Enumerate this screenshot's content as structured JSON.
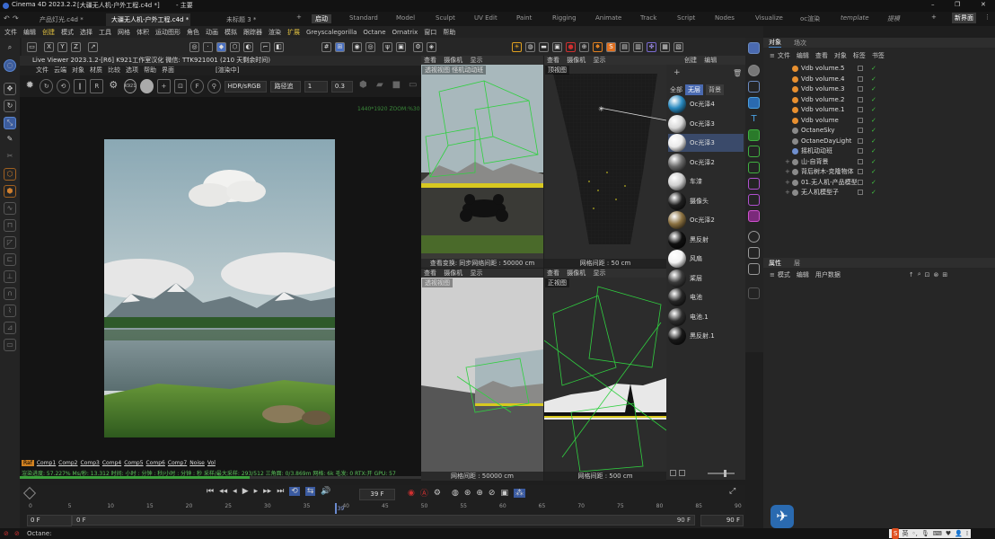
{
  "title": {
    "app_version": "Cinema 4D 2023.2.2",
    "document": "[大疆无人机-户外工程.c4d *]",
    "suffix": "- 主要"
  },
  "window_controls": [
    "–",
    "❐",
    "✕"
  ],
  "doc_tabs": [
    "产品灯光.c4d *",
    "大疆无人机-户外工程.c4d *",
    "未标题 3 *"
  ],
  "layout_tabs": {
    "items": [
      "启动",
      "Standard",
      "Model",
      "Sculpt",
      "UV Edit",
      "Paint",
      "Rigging",
      "Animate",
      "Track",
      "Script",
      "Nodes",
      "Visualize",
      "oc渲染",
      "template",
      "提模"
    ],
    "active": "启动",
    "new_interface": "新界面"
  },
  "menu": [
    "文件",
    "编辑",
    "创建",
    "模式",
    "选择",
    "工具",
    "网格",
    "体积",
    "运动图形",
    "角色",
    "动画",
    "模拟",
    "跟踪器",
    "渲染",
    "扩展",
    "Greyscalegorilla",
    "Octane",
    "Ornatrix",
    "窗口",
    "帮助"
  ],
  "axis_buttons": [
    "X",
    "Y",
    "Z"
  ],
  "live_viewer": {
    "title": "Live Viewer 2023.1.2-[R6]  K921工作室汉化  微信: TTK921001 (210 天剩余时间)",
    "rendering_label": "[渲染中]",
    "menu": [
      "文件",
      "云端",
      "对象",
      "材质",
      "比较",
      "选项",
      "帮助",
      "界面"
    ],
    "logo_text": "K921",
    "colorspace": "HDR/sRGB",
    "mode": "路径追",
    "value1": "1",
    "value2": "0.3",
    "resolution_overlay": "1440*1920 ZOOM:%30",
    "progress_text": "渲染进度: 57.227%  Ms/秒: 13.312  时间: 小时 : 分钟 : 秒/小时 : 分钟 : 秒  采样/最大采样: 293/512  三角面: 0/3.869m  网格: 6k  毛发: 0  RTX:开  GPU: 57",
    "progress_value": 57.227,
    "channel_tags": [
      "Raf",
      "Comp1",
      "Comp2",
      "Comp3",
      "Comp4",
      "Comp5",
      "Comp6",
      "Comp7",
      "Noise",
      "Vol"
    ]
  },
  "viewports": {
    "menu": [
      "查看",
      "摄像机",
      "显示"
    ],
    "tl": {
      "label": "透视视图",
      "camera": "怪机动动班",
      "footer": "查看变换: 同步网络间距 : 50000 cm"
    },
    "tr": {
      "label": "顶视图",
      "footer": "网格间距 : 50 cm"
    },
    "bl": {
      "label": "透视视图",
      "footer": "网格间距 : 50000 cm"
    },
    "br": {
      "label": "正视图",
      "footer": "网格间距 : 500 cm"
    }
  },
  "material_panel": {
    "menu": [
      "创建",
      "编辑"
    ],
    "filters": [
      "全部",
      "无层",
      "背景"
    ],
    "materials": [
      {
        "name": "Oc光泽4",
        "color": "#2a8ac0"
      },
      {
        "name": "Oc光泽3",
        "color": "#d8d8d8"
      },
      {
        "name": "Oc光泽3",
        "color": "#eaeaea"
      },
      {
        "name": "Oc光泽2",
        "color": "#6a6a6a"
      },
      {
        "name": "车漆",
        "color": "#cfcfcf"
      },
      {
        "name": "摄像头",
        "color": "#202020"
      },
      {
        "name": "Oc光泽2",
        "color": "#8a7040"
      },
      {
        "name": "黑反射",
        "color": "#101010"
      },
      {
        "name": "风扇",
        "color": "#f2f2f2"
      },
      {
        "name": "桨层",
        "color": "#3a3a3a"
      },
      {
        "name": "电池",
        "color": "#262626"
      },
      {
        "name": "电池.1",
        "color": "#2e2e2e"
      },
      {
        "name": "黑反射.1",
        "color": "#181818"
      }
    ]
  },
  "object_panel": {
    "tabs": [
      "对象",
      "场次"
    ],
    "menu": [
      "文件",
      "编辑",
      "查看",
      "对象",
      "标签",
      "书签"
    ],
    "objects": [
      {
        "name": "Vdb volume.5",
        "icon_color": "#e89030",
        "indent": 0
      },
      {
        "name": "Vdb volume.4",
        "icon_color": "#e89030",
        "indent": 0
      },
      {
        "name": "Vdb volume.3",
        "icon_color": "#e89030",
        "indent": 0
      },
      {
        "name": "Vdb volume.2",
        "icon_color": "#e89030",
        "indent": 0
      },
      {
        "name": "Vdb volume.1",
        "icon_color": "#e89030",
        "indent": 0
      },
      {
        "name": "Vdb volume",
        "icon_color": "#e89030",
        "indent": 0
      },
      {
        "name": "OctaneSky",
        "icon_color": "#8a8a8a",
        "indent": 0
      },
      {
        "name": "OctaneDayLight",
        "icon_color": "#8a8a8a",
        "indent": 0
      },
      {
        "name": "摇机动动班",
        "icon_color": "#7090d0",
        "indent": 0
      },
      {
        "name": "山-自背景",
        "icon_color": "#8a8a8a",
        "indent": 1
      },
      {
        "name": "背后树木-克隆物体",
        "icon_color": "#8a8a8a",
        "indent": 1
      },
      {
        "name": "01.无人机-产品模型",
        "icon_color": "#8a8a8a",
        "indent": 1
      },
      {
        "name": "无人机模型子",
        "icon_color": "#8a8a8a",
        "indent": 1
      }
    ],
    "attr_tabs": [
      "属性",
      "层"
    ],
    "attr_menu": [
      "模式",
      "编辑",
      "用户数据"
    ]
  },
  "timeline": {
    "current_frame": "39 F",
    "start": "0 F",
    "start2": "0 F",
    "end": "90 F",
    "end2": "90 F",
    "ruler": [
      "0",
      "5",
      "10",
      "15",
      "20",
      "25",
      "30",
      "35",
      "40",
      "45",
      "50",
      "55",
      "60",
      "65",
      "70",
      "75",
      "80",
      "85",
      "90"
    ],
    "playhead": "39",
    "playhead_frame": 39,
    "total_frames": 90
  },
  "status": "Octane:",
  "tray_icons": [
    "英"
  ]
}
